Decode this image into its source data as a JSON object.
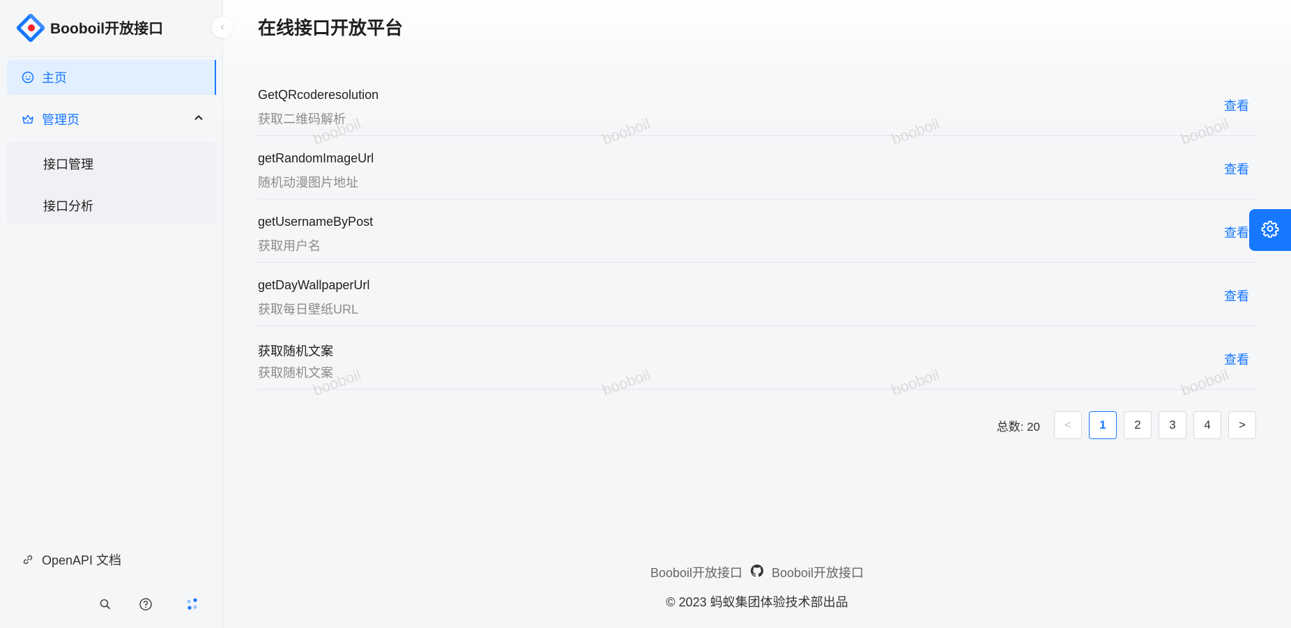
{
  "app": {
    "name": "Booboil开放接口"
  },
  "sidebar": {
    "home": "主页",
    "manage": "管理页",
    "sub_items": [
      "接口管理",
      "接口分析"
    ],
    "openapi": "OpenAPI 文档"
  },
  "main": {
    "title": "在线接口开放平台",
    "items": [
      {
        "name": "GetQRcoderesolution",
        "desc": "获取二维码解析",
        "action": "查看"
      },
      {
        "name": "getRandomImageUrl",
        "desc": "随机动漫图片地址",
        "action": "查看"
      },
      {
        "name": "getUsernameByPost",
        "desc": "获取用户名",
        "action": "查看"
      },
      {
        "name": "getDayWallpaperUrl",
        "desc": "获取每日壁纸URL",
        "action": "查看"
      },
      {
        "name": "获取随机文案",
        "desc": "获取随机文案",
        "action": "查看"
      }
    ],
    "watermark": "booboil"
  },
  "pagination": {
    "total_label": "总数:",
    "total": "20",
    "pages": [
      "1",
      "2",
      "3",
      "4"
    ],
    "current": "1",
    "prev": "<",
    "next": ">"
  },
  "footer": {
    "link_left": "Booboil开放接口",
    "link_right": "Booboil开放接口",
    "copyright": "© 2023 蚂蚁集团体验技术部出品"
  },
  "colors": {
    "accent": "#1677ff",
    "active_bg": "#e1efff"
  },
  "icons": [
    "logo-icon",
    "smile-icon",
    "crown-icon",
    "chevron-up-icon",
    "link-icon",
    "search-icon",
    "question-icon",
    "dots-icon",
    "github-icon",
    "gear-icon",
    "chevron-left-icon",
    "chevron-right-icon"
  ]
}
